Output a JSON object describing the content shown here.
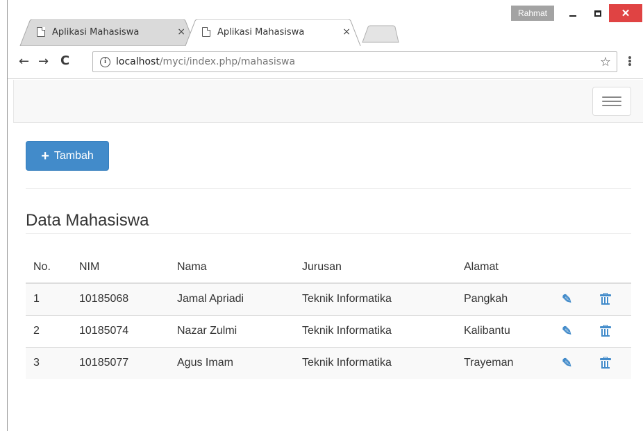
{
  "browser": {
    "tabs": [
      {
        "title": "Aplikasi Mahasiswa",
        "close": "×",
        "active": false
      },
      {
        "title": "Aplikasi Mahasiswa",
        "close": "×",
        "active": true
      }
    ],
    "profile_name": "Rahmat",
    "close_glyph": "✕",
    "nav": {
      "back": "←",
      "forward": "→",
      "reload": "C"
    },
    "url": {
      "info": "i",
      "host": "localhost",
      "path": "/myci/index.php/mahasiswa"
    },
    "star": "☆"
  },
  "page": {
    "add_button_icon": "+",
    "add_button_label": "Tambah",
    "section_title": "Data Mahasiswa",
    "table": {
      "headers": [
        "No.",
        "NIM",
        "Nama",
        "Jurusan",
        "Alamat"
      ],
      "rows": [
        {
          "no": "1",
          "nim": "10185068",
          "nama": "Jamal Apriadi",
          "jurusan": "Teknik Informatika",
          "alamat": "Pangkah"
        },
        {
          "no": "2",
          "nim": "10185074",
          "nama": "Nazar Zulmi",
          "jurusan": "Teknik Informatika",
          "alamat": "Kalibantu"
        },
        {
          "no": "3",
          "nim": "10185077",
          "nama": "Agus Imam",
          "jurusan": "Teknik Informatika",
          "alamat": "Trayeman"
        }
      ],
      "edit_icon": "edit-icon",
      "delete_icon": "trash-icon"
    }
  },
  "colors": {
    "primary": "#428bca",
    "close_button": "#e04343",
    "navbar": "#f8f8f8"
  }
}
